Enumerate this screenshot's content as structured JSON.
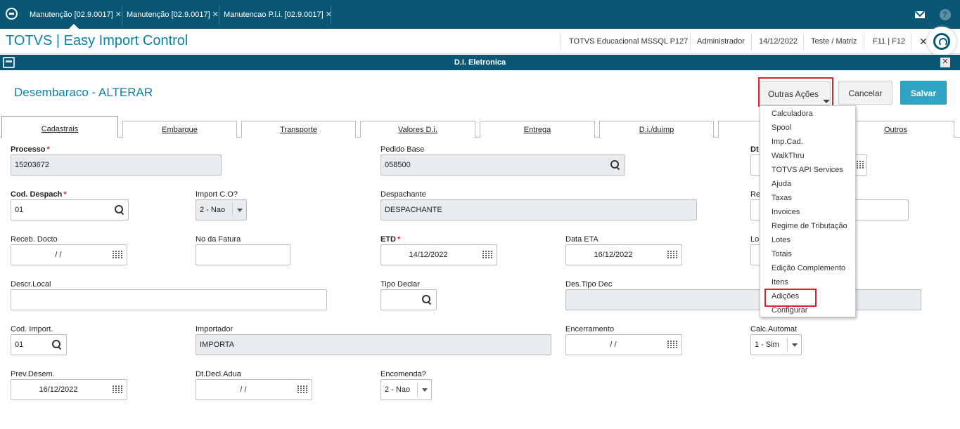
{
  "window_tabs": [
    {
      "label": "Manutenção [02.9.0017]"
    },
    {
      "label": "Manutenção [02.9.0017]"
    },
    {
      "label": "Manutencao P.l.i. [02.9.0017]"
    }
  ],
  "app": {
    "title": "TOTVS | Easy Import Control",
    "environment": "TOTVS Educacional MSSQL P127",
    "user": "Administrador",
    "date": "14/12/2022",
    "branch": "Teste / Matriz",
    "shortcuts": "F11 | F12"
  },
  "dialog": {
    "title": "D.I. Eletronica",
    "form_title": "Desembaraco - ALTERAR",
    "buttons": {
      "more": "Outras Ações",
      "cancel": "Cancelar",
      "save": "Salvar"
    }
  },
  "folder_tabs": [
    "Cadastrais",
    "Embarque",
    "Transporte",
    "Valores D.i.",
    "Entrega",
    "D.i./duimp",
    "Outros"
  ],
  "menu_items": [
    "Calculadora",
    "Spool",
    "Imp.Cad.",
    "WalkThru",
    "TOTVS API Services",
    "Ajuda",
    "Taxas",
    "Invoices",
    "Regime de Tributação",
    "Lotes",
    "Totais",
    "Edição Complemento",
    "Itens",
    "Adições",
    "Configurar"
  ],
  "form": {
    "processo": {
      "label": "Processo",
      "value": "15203672"
    },
    "pedido_base": {
      "label": "Pedido Base",
      "value": "058500"
    },
    "dt": {
      "label": "Dt"
    },
    "cod_despach": {
      "label": "Cod. Despach",
      "value": "01"
    },
    "import_co": {
      "label": "Import C.O?",
      "value": "2 - Nao"
    },
    "despachante": {
      "label": "Despachante",
      "value": "DESPACHANTE"
    },
    "re": {
      "label": "Re"
    },
    "receb_docto": {
      "label": "Receb. Docto",
      "value": "/ /"
    },
    "no_fatura": {
      "label": "No da Fatura",
      "value": ""
    },
    "etd": {
      "label": "ETD",
      "value": "14/12/2022"
    },
    "data_eta": {
      "label": "Data ETA",
      "value": "16/12/2022"
    },
    "lo": {
      "label": "Lo"
    },
    "descr_local": {
      "label": "Descr.Local",
      "value": ""
    },
    "tipo_declar": {
      "label": "Tipo Declar",
      "value": ""
    },
    "des_tipo_dec": {
      "label": "Des.Tipo Dec",
      "value": ""
    },
    "cod_import": {
      "label": "Cod. Import.",
      "value": "01"
    },
    "importador": {
      "label": "Importador",
      "value": "IMPORTA"
    },
    "encerramento": {
      "label": "Encerramento",
      "value": "/ /"
    },
    "calc_automat": {
      "label": "Calc.Automat",
      "value": "1 - Sim"
    },
    "prev_desem": {
      "label": "Prev.Desem.",
      "value": "16/12/2022"
    },
    "dt_decl_adua": {
      "label": "Dt.Decl.Adua",
      "value": "/ /"
    },
    "encomenda": {
      "label": "Encomenda?",
      "value": "2 - Nao"
    }
  },
  "colors": {
    "header_bar": "#0a5775",
    "accent": "#0c80a6",
    "primary_button": "#30a4c5",
    "highlight_box": "#d9252f"
  }
}
